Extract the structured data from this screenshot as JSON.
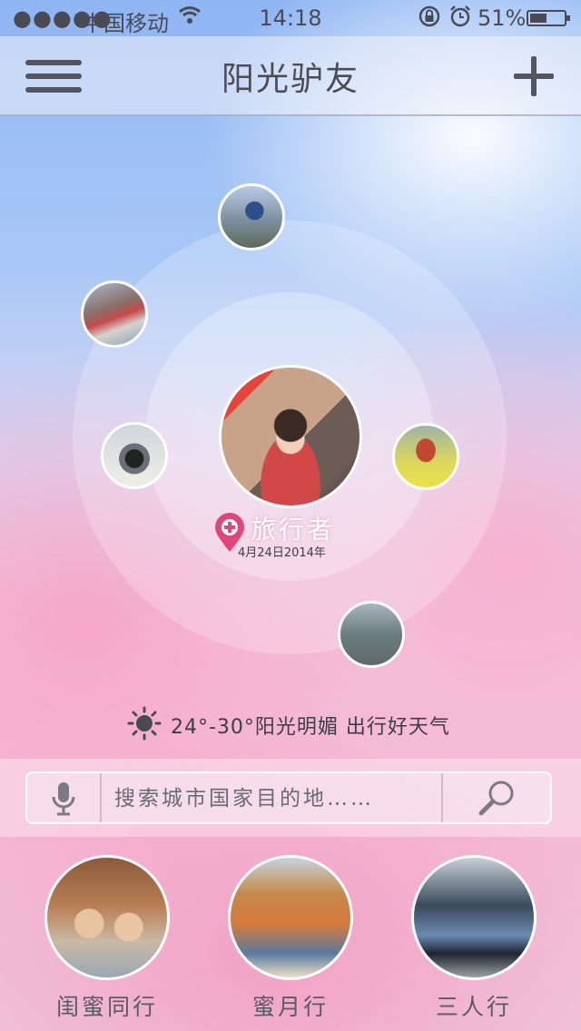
{
  "status_bar": {
    "signal": "●●●●●",
    "carrier": "中国移动",
    "time": "14:18",
    "battery_percent": "51%",
    "battery_level": 0.51,
    "icons": [
      "wifi-icon",
      "rotation-lock-icon",
      "alarm-icon",
      "battery-icon"
    ]
  },
  "nav": {
    "title": "阳光驴友",
    "icons": [
      "menu-icon",
      "plus-icon"
    ]
  },
  "traveler": {
    "label": "旅行者",
    "date": "4月24日2014年"
  },
  "weather": {
    "icon": "sun-icon",
    "text": "24°-30°阳光明媚 出行好天气"
  },
  "search": {
    "placeholder": "搜索城市国家目的地……",
    "icons": [
      "microphone-icon",
      "magnifier-icon"
    ]
  },
  "categories": [
    {
      "label": "闺蜜同行"
    },
    {
      "label": "蜜月行"
    },
    {
      "label": "三人行"
    }
  ],
  "colors": {
    "text": "#4c4c55",
    "pin": "#e0467a",
    "sky": "#8fb6f3",
    "blossom": "#f5b9d4"
  }
}
